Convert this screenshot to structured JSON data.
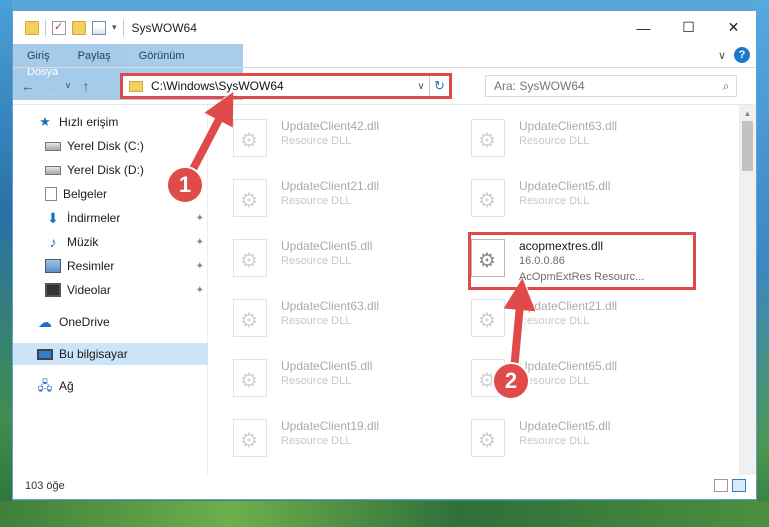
{
  "window": {
    "title": "SysWOW64",
    "minimize": "—",
    "maximize": "☐",
    "close": "✕"
  },
  "ribbon": {
    "tabs": [
      "Dosya",
      "Giriş",
      "Paylaş",
      "Görünüm"
    ],
    "collapse_icon": "∨",
    "help": "?"
  },
  "navigation": {
    "back": "←",
    "forward": "→",
    "recent": "∨",
    "up": "↑"
  },
  "address": {
    "path": "C:\\Windows\\SysWOW64",
    "dropdown": "∨",
    "refresh": "↻"
  },
  "search": {
    "placeholder": "Ara: SysWOW64"
  },
  "sidebar": {
    "items": [
      {
        "label": "Hızlı erişim",
        "icon": "star-icon",
        "pinned": false
      },
      {
        "label": "Yerel Disk (C:)",
        "icon": "drive-icon",
        "pinned": true
      },
      {
        "label": "Yerel Disk (D:)",
        "icon": "drive-icon",
        "pinned": true
      },
      {
        "label": "Belgeler",
        "icon": "document-icon",
        "pinned": true
      },
      {
        "label": "İndirmeler",
        "icon": "download-icon",
        "pinned": true
      },
      {
        "label": "Müzik",
        "icon": "music-icon",
        "pinned": true
      },
      {
        "label": "Resimler",
        "icon": "pictures-icon",
        "pinned": true
      },
      {
        "label": "Videolar",
        "icon": "video-icon",
        "pinned": true
      },
      {
        "label": "OneDrive",
        "icon": "cloud-icon",
        "pinned": false
      },
      {
        "label": "Bu bilgisayar",
        "icon": "computer-icon",
        "pinned": false,
        "selected": true
      },
      {
        "label": "Ağ",
        "icon": "network-icon",
        "pinned": false
      }
    ],
    "pin_glyph": "📌"
  },
  "files": [
    {
      "name": "UpdateClient42.dll",
      "desc": "Resource DLL"
    },
    {
      "name": "UpdateClient63.dll",
      "desc": "Resource DLL"
    },
    {
      "name": "UpdateClient21.dll",
      "desc": "Resource DLL"
    },
    {
      "name": "UpdateClient5.dll",
      "desc": "Resource DLL"
    },
    {
      "name": "UpdateClient5.dll",
      "desc": "Resource DLL"
    },
    {
      "name": "acopmextres.dll",
      "version": "16.0.0.86",
      "desc": "AcOpmExtRes Resourc..."
    },
    {
      "name": "UpdateClient63.dll",
      "desc": "Resource DLL"
    },
    {
      "name": "UpdateClient21.dll",
      "desc": "Resource DLL"
    },
    {
      "name": "UpdateClient5.dll",
      "desc": "Resource DLL"
    },
    {
      "name": "UpdateClient65.dll",
      "desc": "Resource DLL"
    },
    {
      "name": "UpdateClient19.dll",
      "desc": "Resource DLL"
    },
    {
      "name": "UpdateClient5.dll",
      "desc": "Resource DLL"
    }
  ],
  "status": {
    "item_count": "103 öğe"
  },
  "annotations": {
    "step1": "1",
    "step2": "2",
    "color": "#e04a4a"
  }
}
